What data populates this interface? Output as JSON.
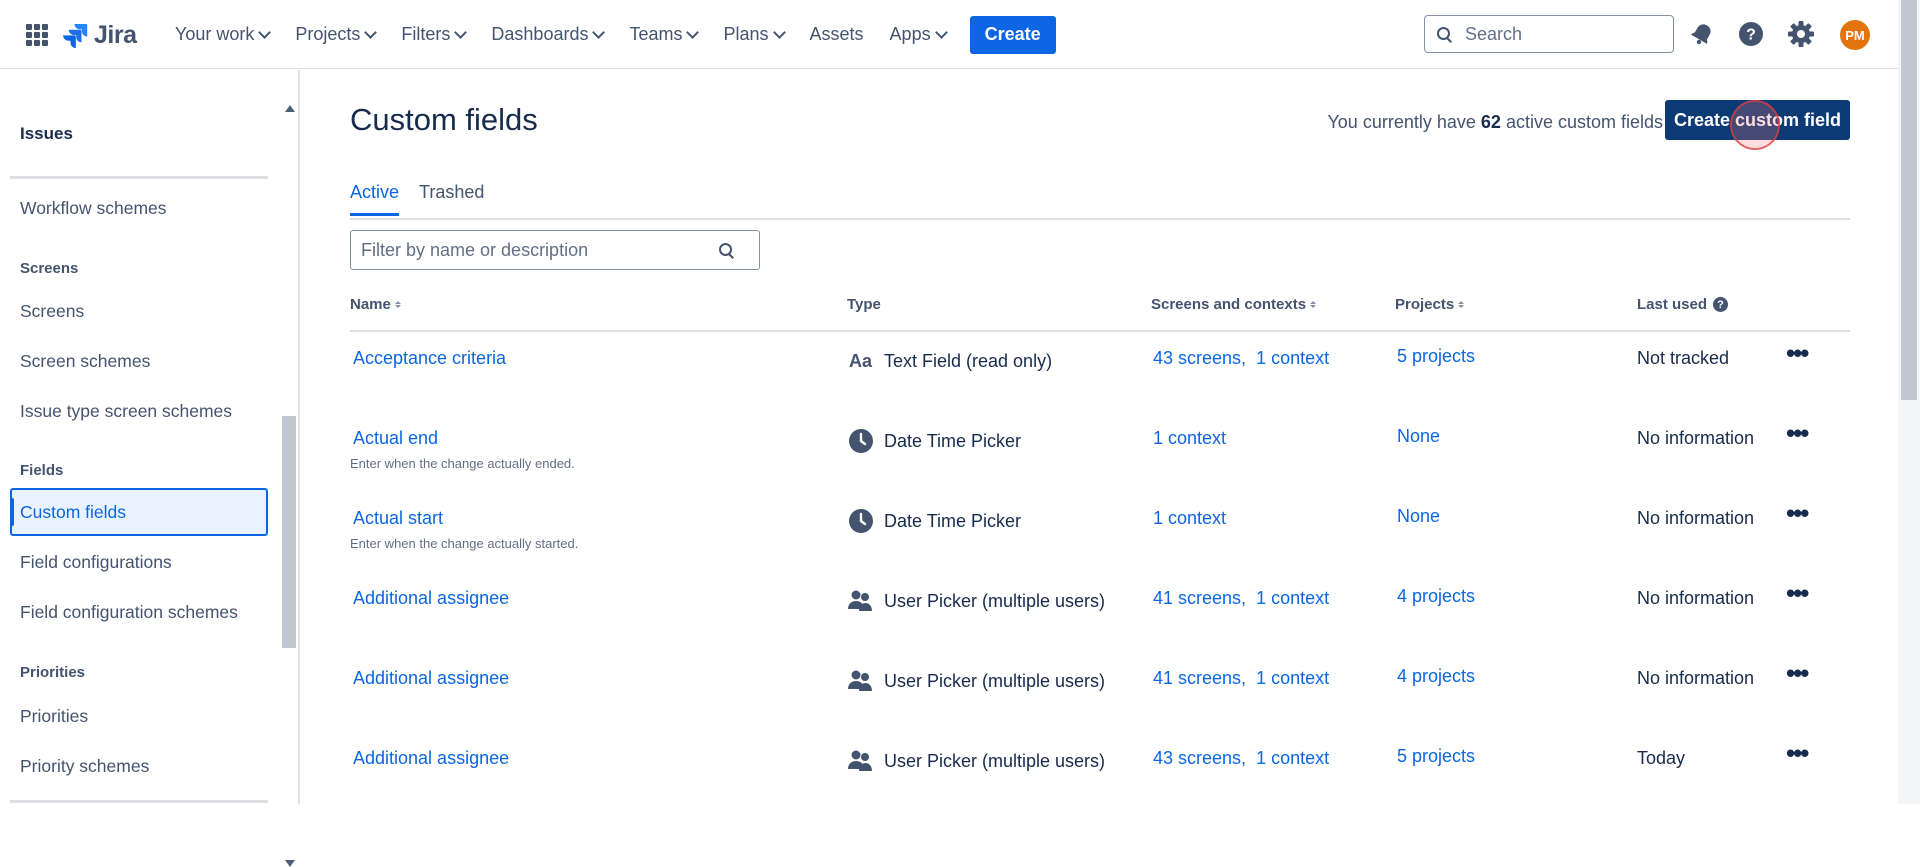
{
  "topnav": {
    "logo_text": "Jira",
    "items": [
      "Your work",
      "Projects",
      "Filters",
      "Dashboards",
      "Teams",
      "Plans",
      "Assets",
      "Apps"
    ],
    "create_label": "Create",
    "search_placeholder": "Search",
    "avatar_initials": "PM",
    "avatar_color": "#e2740d",
    "icons": [
      "notification-icon",
      "help-icon",
      "settings-icon"
    ]
  },
  "sidebar": {
    "heading": "Issues",
    "workflow_schemes": "Workflow schemes",
    "sec_screens": "Screens",
    "screens": "Screens",
    "screen_schemes": "Screen schemes",
    "issue_type_screen_schemes": "Issue type screen schemes",
    "sec_fields": "Fields",
    "custom_fields": "Custom fields",
    "field_configurations": "Field configurations",
    "field_configuration_schemes": "Field configuration schemes",
    "sec_priorities": "Priorities",
    "priorities": "Priorities",
    "priority_schemes": "Priority schemes"
  },
  "main": {
    "title": "Custom fields",
    "count_prefix": "You currently have",
    "count": "62",
    "count_suffix": "active custom fields",
    "create_button": "Create custom field",
    "tabs": [
      "Active",
      "Trashed"
    ],
    "filter_placeholder": "Filter by name or description",
    "columns": {
      "name": "Name",
      "type": "Type",
      "screens": "Screens and contexts",
      "projects": "Projects",
      "last_used": "Last used"
    },
    "rows": [
      {
        "name": "Acceptance criteria",
        "desc": "",
        "type_icon": "text-field-icon",
        "type": "Text Field (read only)",
        "screens": "43 screens,",
        "contexts": "1 context",
        "projects": "5 projects",
        "last_used": "Not tracked"
      },
      {
        "name": "Actual end",
        "desc": "Enter when the change actually ended.",
        "type_icon": "clock-icon",
        "type": "Date Time Picker",
        "screens": "",
        "contexts": "1 context",
        "projects": "None",
        "last_used": "No information"
      },
      {
        "name": "Actual start",
        "desc": "Enter when the change actually started.",
        "type_icon": "clock-icon",
        "type": "Date Time Picker",
        "screens": "",
        "contexts": "1 context",
        "projects": "None",
        "last_used": "No information"
      },
      {
        "name": "Additional assignee",
        "desc": "",
        "type_icon": "users-icon",
        "type": "User Picker (multiple users)",
        "screens": "41 screens,",
        "contexts": "1 context",
        "projects": "4 projects",
        "last_used": "No information"
      },
      {
        "name": "Additional assignee",
        "desc": "",
        "type_icon": "users-icon",
        "type": "User Picker (multiple users)",
        "screens": "41 screens,",
        "contexts": "1 context",
        "projects": "4 projects",
        "last_used": "No information"
      },
      {
        "name": "Additional assignee",
        "desc": "",
        "type_icon": "users-icon",
        "type": "User Picker (multiple users)",
        "screens": "43 screens,",
        "contexts": "1 context",
        "projects": "5 projects",
        "last_used": "Today"
      }
    ]
  },
  "colors": {
    "link": "#0c66e4",
    "primary_button": "#0c66e4",
    "dark_button": "#0c3a75",
    "text": "#172b4d",
    "subtle_text": "#44546f"
  }
}
